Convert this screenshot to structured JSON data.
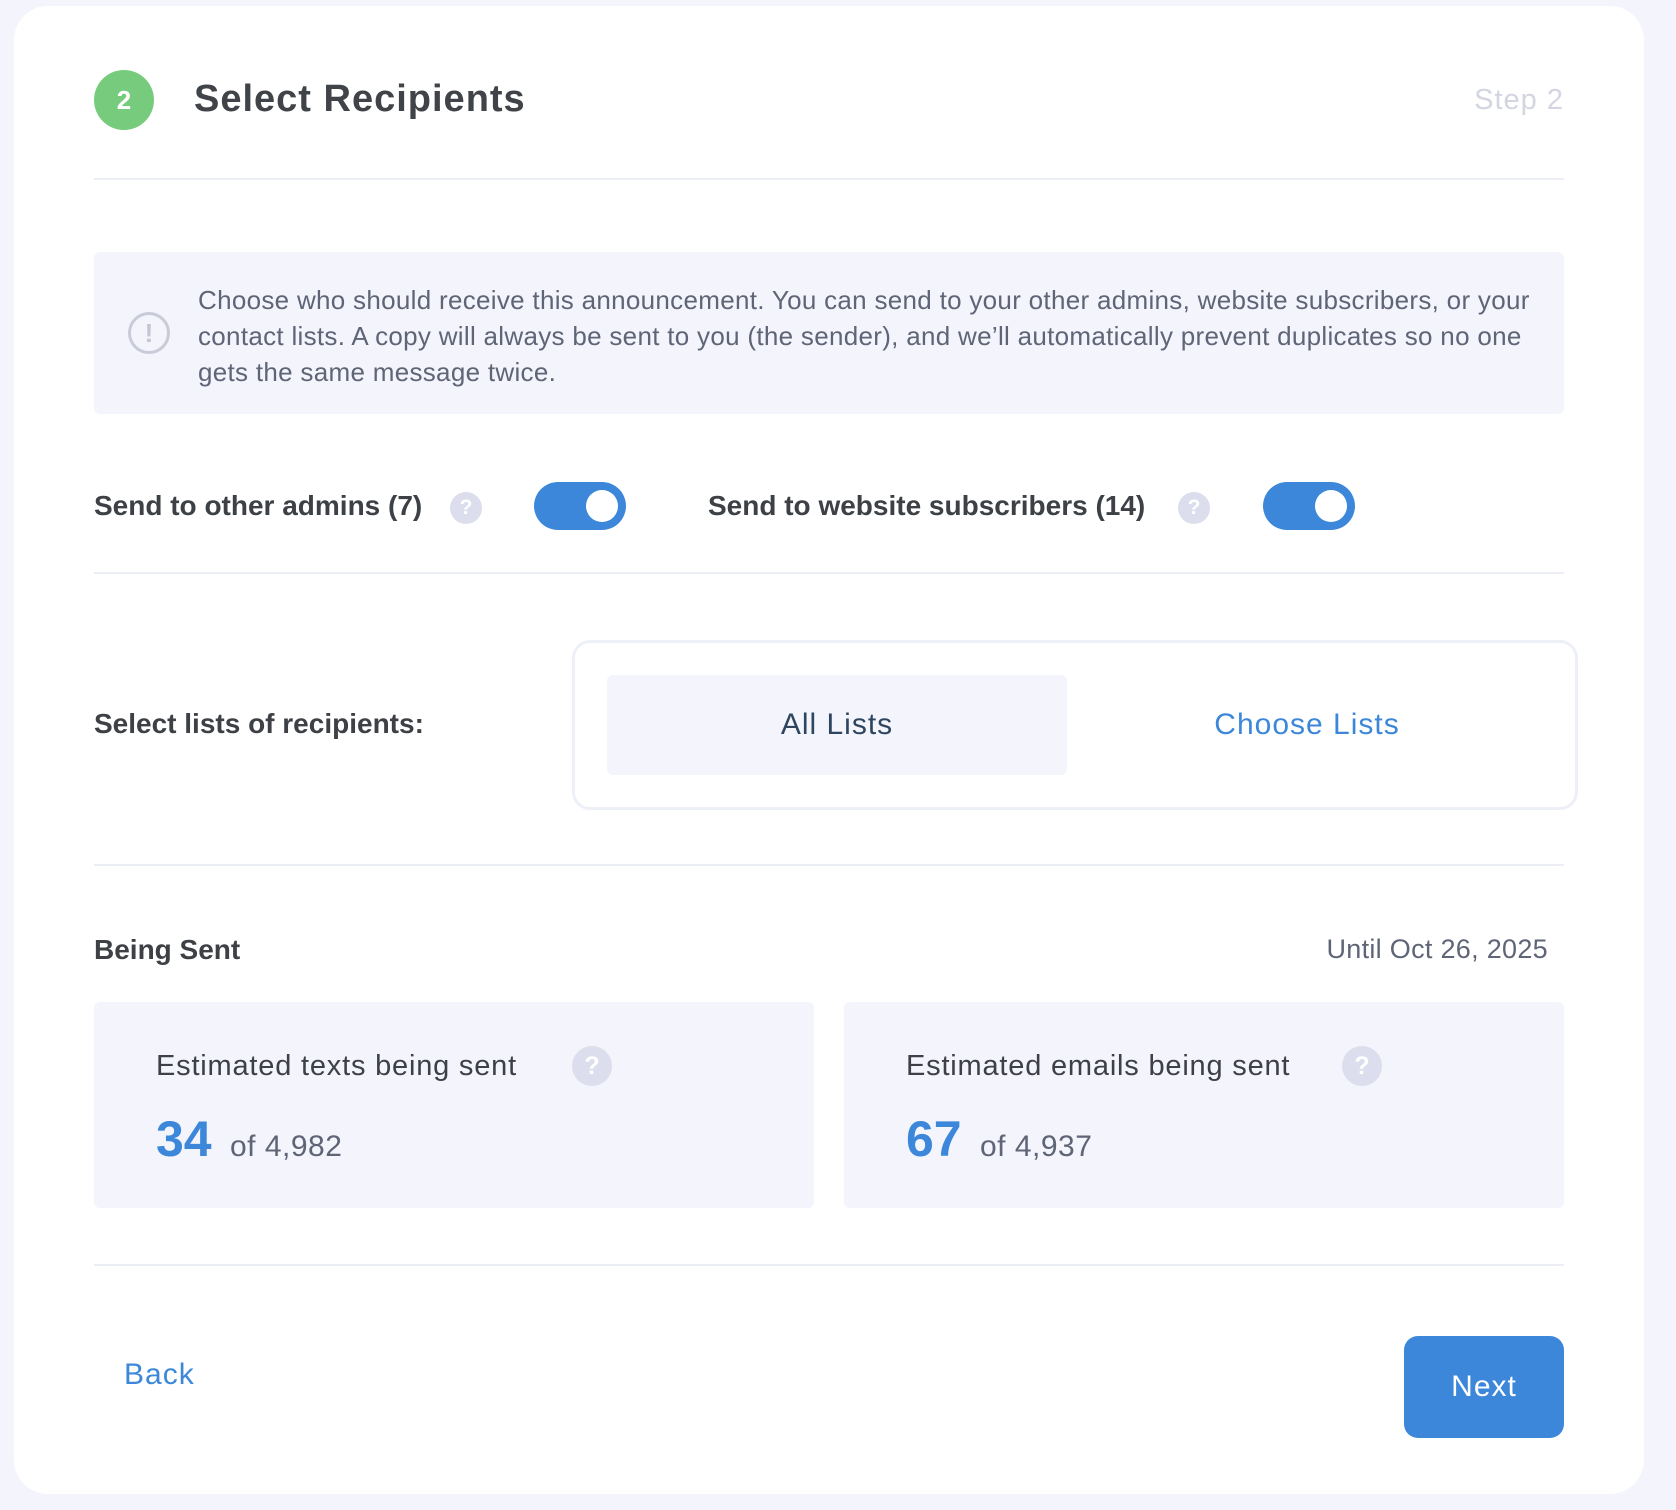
{
  "header": {
    "step_number": "2",
    "title": "Select Recipients",
    "step_label": "Step 2"
  },
  "info": {
    "icon": "exclamation-circle-icon",
    "text": "Choose who should receive this announcement. You can send to your other admins, website subscribers, or your contact lists. A copy will always be sent to you (the sender), and we’ll automatically prevent duplicates so no one gets the same message twice."
  },
  "toggles": {
    "admins": {
      "label": "Send to other admins (7)",
      "on": true
    },
    "subscribers": {
      "label": "Send to website subscribers (14)",
      "on": true
    },
    "help_glyph": "?"
  },
  "lists": {
    "label": "Select lists of recipients:",
    "options": [
      "All Lists",
      "Choose Lists"
    ],
    "selected": "All Lists"
  },
  "being_sent": {
    "title": "Being Sent",
    "until": "Until Oct 26, 2025",
    "texts": {
      "label": "Estimated texts being sent",
      "value": "34",
      "of": "of 4,982"
    },
    "emails": {
      "label": "Estimated emails being sent",
      "value": "67",
      "of": "of 4,937"
    }
  },
  "footer": {
    "back_label": "Back",
    "next_label": "Next"
  },
  "colors": {
    "accent": "#3c87d9",
    "step_badge": "#76cc7c",
    "panel_bg": "#f3f4fc"
  }
}
